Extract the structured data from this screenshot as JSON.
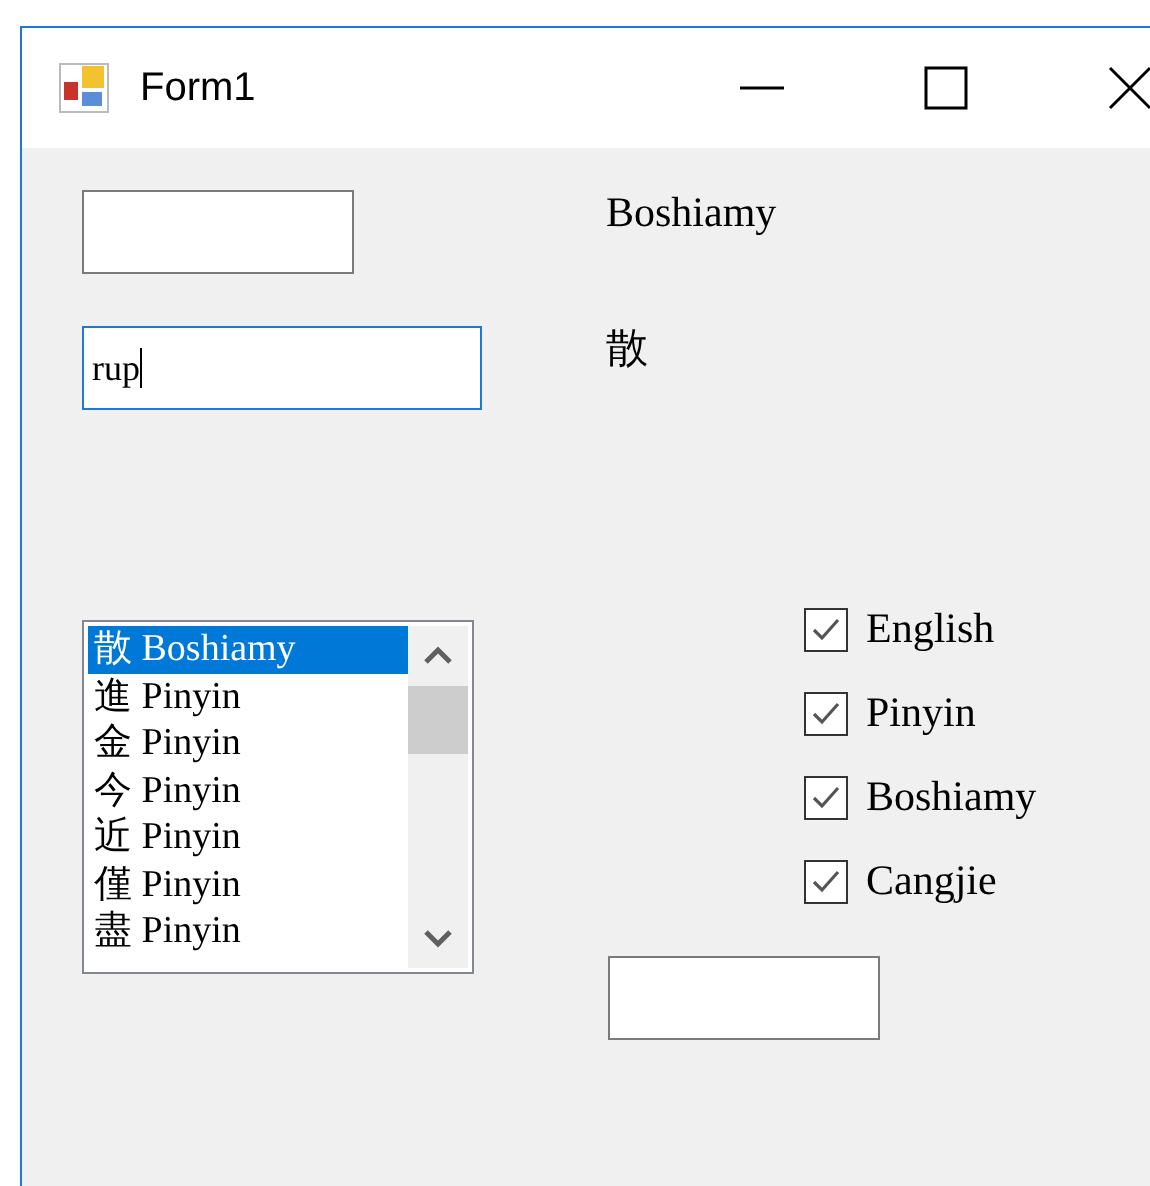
{
  "window": {
    "title": "Form1"
  },
  "left_text_boxes": [
    {
      "focused": false
    },
    {
      "value": "rup",
      "focused": true
    }
  ],
  "list_box": {
    "items": [
      {
        "text": "散 Boshiamy",
        "selected": true
      },
      {
        "text": "進 Pinyin",
        "selected": false
      },
      {
        "text": "金 Pinyin",
        "selected": false
      },
      {
        "text": "今 Pinyin",
        "selected": false
      },
      {
        "text": "近 Pinyin",
        "selected": false
      },
      {
        "text": "僅 Pinyin",
        "selected": false
      },
      {
        "text": "盡 Pinyin",
        "selected": false
      }
    ]
  },
  "labels": [
    "Boshiamy",
    "散"
  ],
  "checkboxes": [
    {
      "label": "English",
      "checked": true
    },
    {
      "label": "Pinyin",
      "checked": true
    },
    {
      "label": "Boshiamy",
      "checked": true
    },
    {
      "label": "Cangjie",
      "checked": true
    }
  ],
  "bottom_text_box": {
    "focused": false
  }
}
